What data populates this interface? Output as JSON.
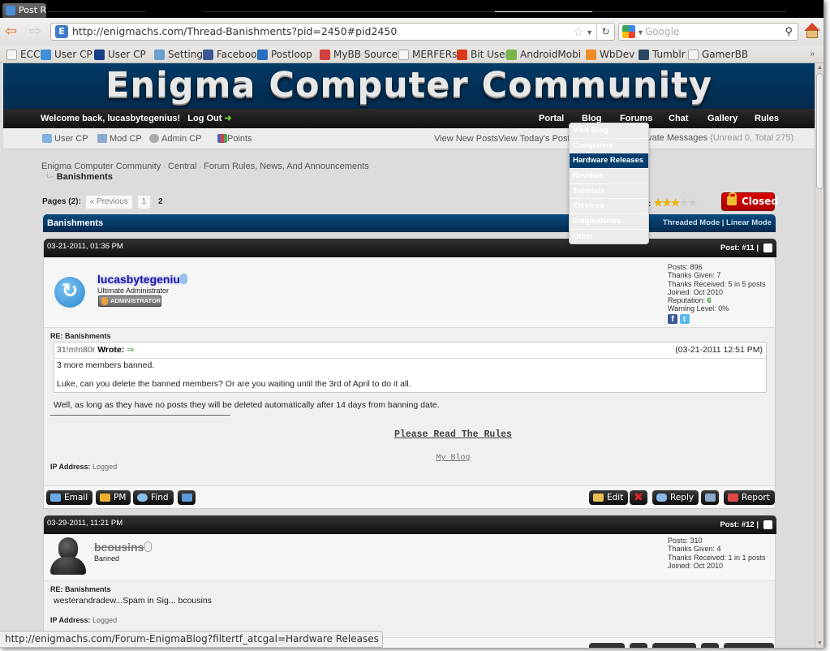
{
  "browser": {
    "tab_title": "Post R",
    "url": "http://enigmachs.com/Thread-Banishments?pid=2450#pid2450",
    "url_icon": "E",
    "search_engine": "Google",
    "status_url": "http://enigmachs.com/Forum-EnigmaBlog?filtertf_atcgal=Hardware Releases",
    "bookmarks": [
      {
        "label": "ECC",
        "icon": "page-icon",
        "color": "#f4f4f4"
      },
      {
        "label": "User CP",
        "icon": "bird-icon",
        "color": "#3d8fd8"
      },
      {
        "label": "User CP",
        "icon": "cf-icon",
        "color": "#1a3d8a"
      },
      {
        "label": "Settings",
        "icon": "settings-icon",
        "color": "#6aa0d0"
      },
      {
        "label": "Facebook",
        "icon": "facebook-icon",
        "color": "#3b5998"
      },
      {
        "label": "Postloop",
        "icon": "postloop-icon",
        "color": "#2a6fc0"
      },
      {
        "label": "MyBB Source",
        "icon": "tools-icon",
        "color": "#d04040"
      },
      {
        "label": "MERFERs",
        "icon": "page-icon",
        "color": "#f4f4f4"
      },
      {
        "label": "Bit User",
        "icon": "bituser-icon",
        "color": "#d83a1a"
      },
      {
        "label": "AndroidMobi",
        "icon": "android-icon",
        "color": "#7ab648"
      },
      {
        "label": "WbDev",
        "icon": "wbdev-icon",
        "color": "#f08a24"
      },
      {
        "label": "Tumblr",
        "icon": "tumblr-icon",
        "color": "#2c4762"
      },
      {
        "label": "GamerBB",
        "icon": "page-icon",
        "color": "#f4f4f4"
      }
    ]
  },
  "site": {
    "logo": "Enigma Computer Community",
    "welcome": "Welcome back, lucasbytegenius!",
    "logout": "Log Out",
    "topnav": [
      "Portal",
      "Blog",
      "Forums",
      "Chat",
      "Gallery",
      "Rules"
    ],
    "subnav": [
      {
        "label": "User CP",
        "icon": "usercp-icon",
        "color": "#7fb2e0"
      },
      {
        "label": "Mod CP",
        "icon": "modcp-icon",
        "color": "#8aa9d0"
      },
      {
        "label": "Admin CP",
        "icon": "gear-icon",
        "color": "#aaaaaa"
      },
      {
        "label": "Points",
        "icon": "chart-icon",
        "color": "#5060c0"
      }
    ],
    "view_new_posts": "View New Posts",
    "view_todays_posts": "View Today's Posts",
    "private_messages": "vate Messages",
    "pm_counts": "(Unread 0, Total 275)"
  },
  "blog_dropdown": {
    "items": [
      "Visit Blog",
      "Computers",
      "Hardware Releases",
      "Reviews",
      "Tutorials",
      "iDevices",
      "EnigmaNews",
      "Other"
    ],
    "selected": "Hardware Releases"
  },
  "breadcrumb": {
    "items": [
      "Enigma Computer Community",
      "Central",
      "Forum Rules, News, And Announcements"
    ],
    "current": "Banishments"
  },
  "pagination": {
    "label": "Pages (2):",
    "previous": "« Previous",
    "pages": [
      "1"
    ],
    "current": "2"
  },
  "thread": {
    "rating_label": "g:",
    "rating": 3,
    "rating_max": 5,
    "status": "Closed",
    "title": "Banishments",
    "modes": "Threaded Mode | Linear Mode"
  },
  "posts": [
    {
      "date": "03-21-2011, 01:36 PM",
      "post_number": "Post: #11 |",
      "username": "lucasbytegenius",
      "user_title": "Ultimate Administrator",
      "badge": "ADMINISTRATOR",
      "stats": {
        "posts": "Posts: 896",
        "thanks_given": "Thanks Given: 7",
        "thanks_received": "Thanks Received: 5 in 5 posts",
        "joined": "Joined: Oct 2010",
        "reputation_label": "Reputation:",
        "reputation": "6",
        "warning": "Warning Level: 0%"
      },
      "subject": "RE: Banishments",
      "quote": {
        "author": "31!m!n80r",
        "wrote": "Wrote:",
        "date": "(03-21-2011 12:51 PM)",
        "lines": [
          "3 more members banned.",
          "Luke, can you delete the banned members? Or are you waiting until the 3rd of April to do it all."
        ]
      },
      "message": "Well, as long as they have no posts they will be deleted automatically after 14 days from banning date.",
      "signature": {
        "rules_link": "Please Read The Rules",
        "blog_link": "My Blog"
      },
      "ip_label": "IP Address:",
      "ip_value": "Logged",
      "buttons_left": [
        "Email",
        "PM",
        "Find"
      ],
      "buttons_right": [
        "Edit",
        "Reply",
        "Report"
      ]
    },
    {
      "date": "03-29-2011, 11:21 PM",
      "post_number": "Post: #12 |",
      "username": "bcousins",
      "user_title": "Banned",
      "stats": {
        "posts": "Posts: 310",
        "thanks_given": "Thanks Given: 4",
        "thanks_received": "Thanks Received: 1 in 1 posts",
        "joined": "Joined: Oct 2010"
      },
      "subject": "RE: Banishments",
      "message": "westerandradew...Spam in Sig... bcousins",
      "ip_label": "IP Address:",
      "ip_value": "Logged"
    }
  ],
  "colors": {
    "header_blue": "#033a66",
    "closed_red": "#cc0000",
    "admin_name": "#1a1aa0",
    "reputation_green": "#2a9a2a",
    "dropdown_selected": "#023e6e"
  }
}
